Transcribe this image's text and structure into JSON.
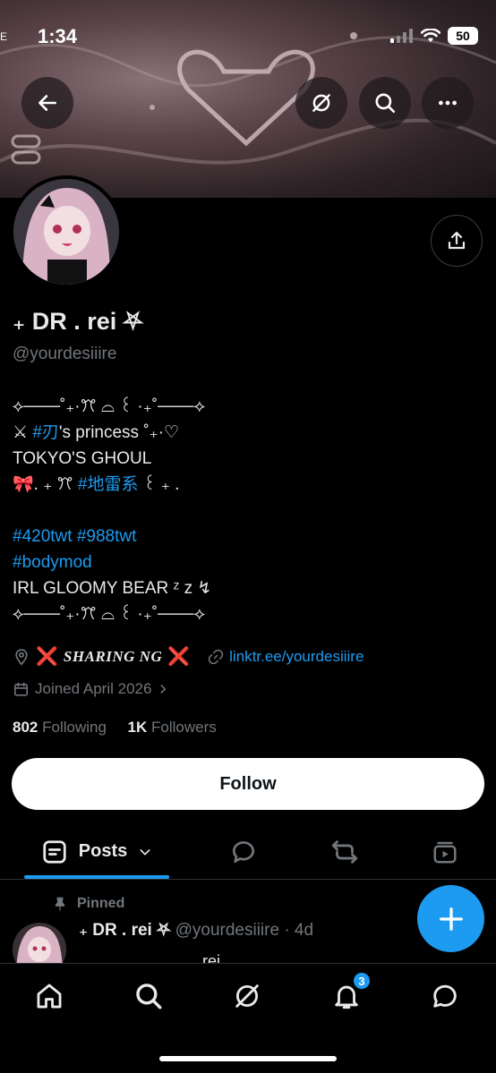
{
  "status_bar": {
    "time": "1:34",
    "edge_label": "E",
    "battery": "50"
  },
  "profile": {
    "display_name": "₊ DR . rei ⛧",
    "handle": "@yourdesiiire"
  },
  "bio": {
    "line1": "⟡───˚₊·ꔫ ⌓ ꒰ ·₊˚───⟡",
    "line2_prefix": "⚔ ",
    "line2_hashtag": "#刃",
    "line2_suffix": "'s princess ˚₊·♡",
    "line3": "TOKYO'S GHOUL",
    "line4_prefix": "🎀. ₊ ꔫ ",
    "line4_hashtag": "#地雷系",
    "line4_suffix": " ꒰ ₊ .",
    "line5_hashtags": " #420twt #988twt",
    "line6_hashtags": " #bodymod",
    "line7": "IRL GLOOMY BEAR ᶻ z ↯",
    "line8": "⟡───˚₊·ꔫ ⌓ ꒰ ·₊˚───⟡"
  },
  "meta": {
    "location_mark": "❌",
    "location_text": "SHARING NG",
    "link_text": "linktr.ee/yourdesiiire",
    "joined_text": "Joined April 2026"
  },
  "stats": {
    "following_count": "802",
    "following_label": "Following",
    "followers_count": "1K",
    "followers_label": "Followers"
  },
  "follow_button_label": "Follow",
  "tabs": {
    "posts_label": "Posts"
  },
  "pinned_post": {
    "pinned_label": "Pinned",
    "author_name": "₊ DR . rei ⛧",
    "author_handle": "@yourdesiiire",
    "time": "· 4d",
    "preview": "rei"
  },
  "notifications_badge": "3",
  "colors": {
    "accent": "#1d9bf0",
    "background": "#000000",
    "muted": "#71767b",
    "text": "#e7e9ea",
    "warning": "#e0202c"
  },
  "icons": {
    "back": "arrow-left-icon",
    "grok": "grok-icon",
    "search": "search-icon",
    "more": "more-icon",
    "share": "share-icon",
    "location": "location-icon",
    "link": "link-icon",
    "calendar": "calendar-icon",
    "replies": "reply-icon",
    "reposts": "repost-icon",
    "media": "media-icon",
    "compose": "plus-icon",
    "home": "home-icon",
    "notifications": "bell-icon",
    "messages": "message-icon"
  }
}
